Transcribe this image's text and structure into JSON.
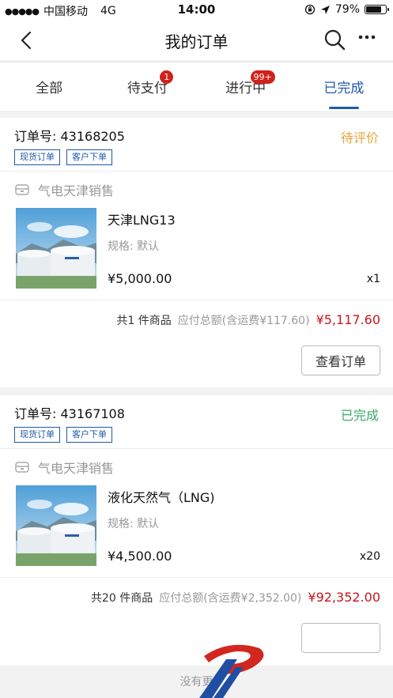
{
  "status_bar": {
    "signal": "●●●●●",
    "carrier": "中国移动",
    "network": "4G",
    "time": "14:00",
    "battery_percent": "79%",
    "battery_level": 0.79
  },
  "nav": {
    "title": "我的订单"
  },
  "tabs": [
    {
      "label": "全部",
      "badge": "",
      "active": false
    },
    {
      "label": "待支付",
      "badge": "1",
      "active": false
    },
    {
      "label": "进行中",
      "badge": "99+",
      "active": false
    },
    {
      "label": "已完成",
      "badge": "",
      "active": true
    }
  ],
  "orders": [
    {
      "order_no": "订单号: 43168205",
      "state": "待评价",
      "state_color": "#e9a33c",
      "tags": [
        "现货订单",
        "客户下单"
      ],
      "seller": "气电天津销售",
      "product_name": "天津LNG13",
      "spec": "规格: 默认",
      "price": "¥5,000.00",
      "qty": "x1",
      "count_text": "共1 件商品",
      "total_label": "应付总额(含运费¥117.60)",
      "total": "¥5,117.60",
      "action": "查看订单"
    },
    {
      "order_no": "订单号: 43167108",
      "state": "已完成",
      "state_color": "#3aa86b",
      "tags": [
        "现货订单",
        "客户下单"
      ],
      "seller": "气电天津销售",
      "product_name": "液化天然气（LNG)",
      "spec": "规格: 默认",
      "price": "¥4,500.00",
      "qty": "x20",
      "count_text": "共20 件商品",
      "total_label": "应付总额(含运费¥2,352.00)",
      "total": "¥92,352.00",
      "action": ""
    }
  ],
  "footer": {
    "text": "没有更"
  }
}
